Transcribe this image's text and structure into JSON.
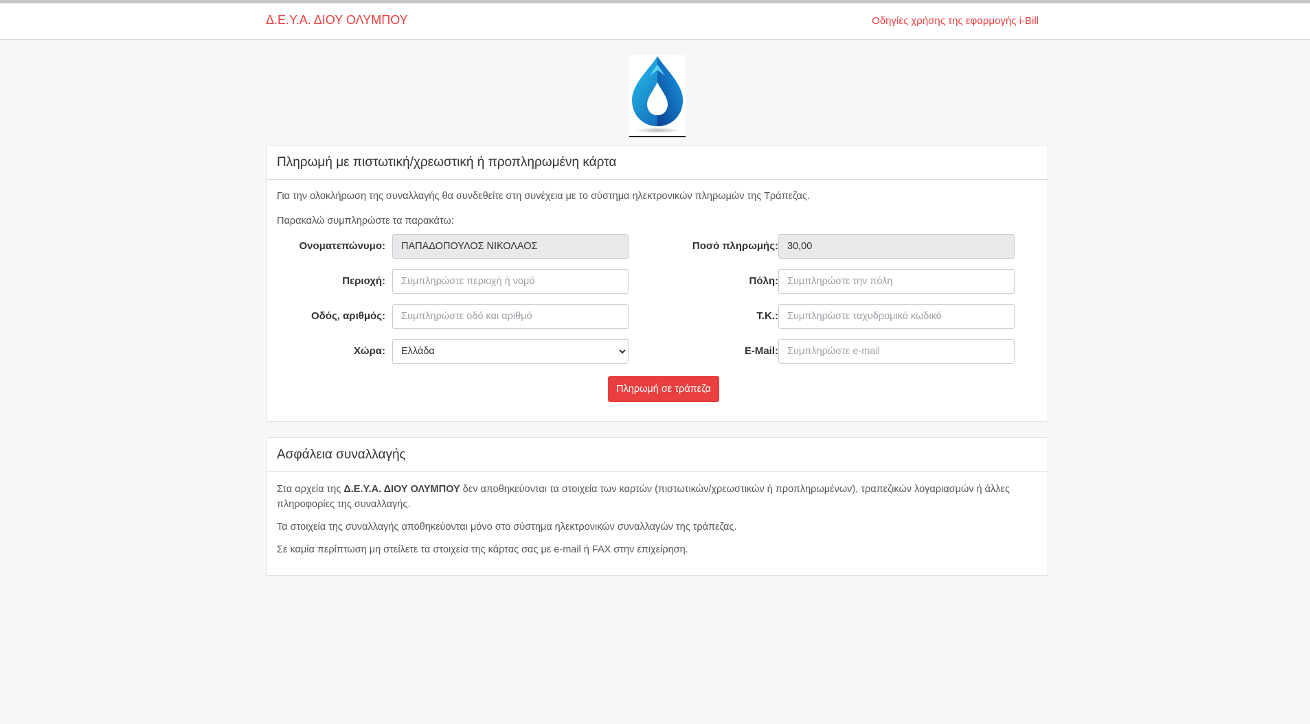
{
  "navbar": {
    "brand": "Δ.Ε.Υ.Α. ΔΙΟΥ ΟΛΥΜΠΟΥ",
    "help_link": "Οδηγίες χρήσης της εφαρμογής i-Bill"
  },
  "logo": {
    "icon": "water-drop-icon"
  },
  "payment_card": {
    "title": "Πληρωμή με πιστωτική/χρεωστική ή προπληρωμένη κάρτα",
    "intro": "Για την ολοκλήρωση της συναλλαγής θα συνδεθείτε στη συνέχεια με το σύστημα ηλεκτρονικών πληρωμών της Τράπεζας.",
    "instruction": "Παρακαλώ συμπληρώστε τα παρακάτω:",
    "fields": {
      "fullname": {
        "label": "Ονοματεπώνυμο:",
        "value": "ΠΑΠΑΔΟΠΟΥΛΟΣ ΝΙΚΟΛΑΟΣ"
      },
      "amount": {
        "label": "Ποσό πληρωμής:",
        "value": "30,00"
      },
      "region": {
        "label": "Περιοχή:",
        "placeholder": "Συμπληρώστε περιοχή ή νομό"
      },
      "city": {
        "label": "Πόλη:",
        "placeholder": "Συμπληρώστε την πόλη"
      },
      "street": {
        "label": "Οδός, αριθμός:",
        "placeholder": "Συμπληρώστε οδό και αριθμό"
      },
      "postal": {
        "label": "Τ.Κ.:",
        "placeholder": "Συμπληρώστε ταχυδρομικό κωδικό"
      },
      "country": {
        "label": "Χώρα:",
        "selected": "Ελλάδα"
      },
      "email": {
        "label": "E-Mail:",
        "placeholder": "Συμπληρώστε e-mail"
      }
    },
    "submit_label": "Πληρωμή σε τράπεζα"
  },
  "security_card": {
    "title": "Ασφάλεια συναλλαγής",
    "p1_before": "Στα αρχεία της ",
    "p1_bold": "Δ.Ε.Υ.Α. ΔΙΟΥ ΟΛΥΜΠΟΥ",
    "p1_after": " δεν αποθηκεύονται τα στοιχεία των καρτών (πιστωτικών/χρεωστικών ή προπληρωμένων), τραπεζικών λογαριασμών ή άλλες πληροφορίες της συναλλαγής.",
    "p2": "Τα στοιχεία της συναλλαγής αποθηκεύονται μόνο στο σύστημα ηλεκτρονικών συναλλαγών της τράπεζας.",
    "p3": "Σε καμία περίπτωση μη στείλετε τα στοιχεία της κάρτας σας με e-mail ή FAX στην επιχείρηση."
  },
  "colors": {
    "accent": "#e8403f",
    "background": "#f5f7f9"
  }
}
